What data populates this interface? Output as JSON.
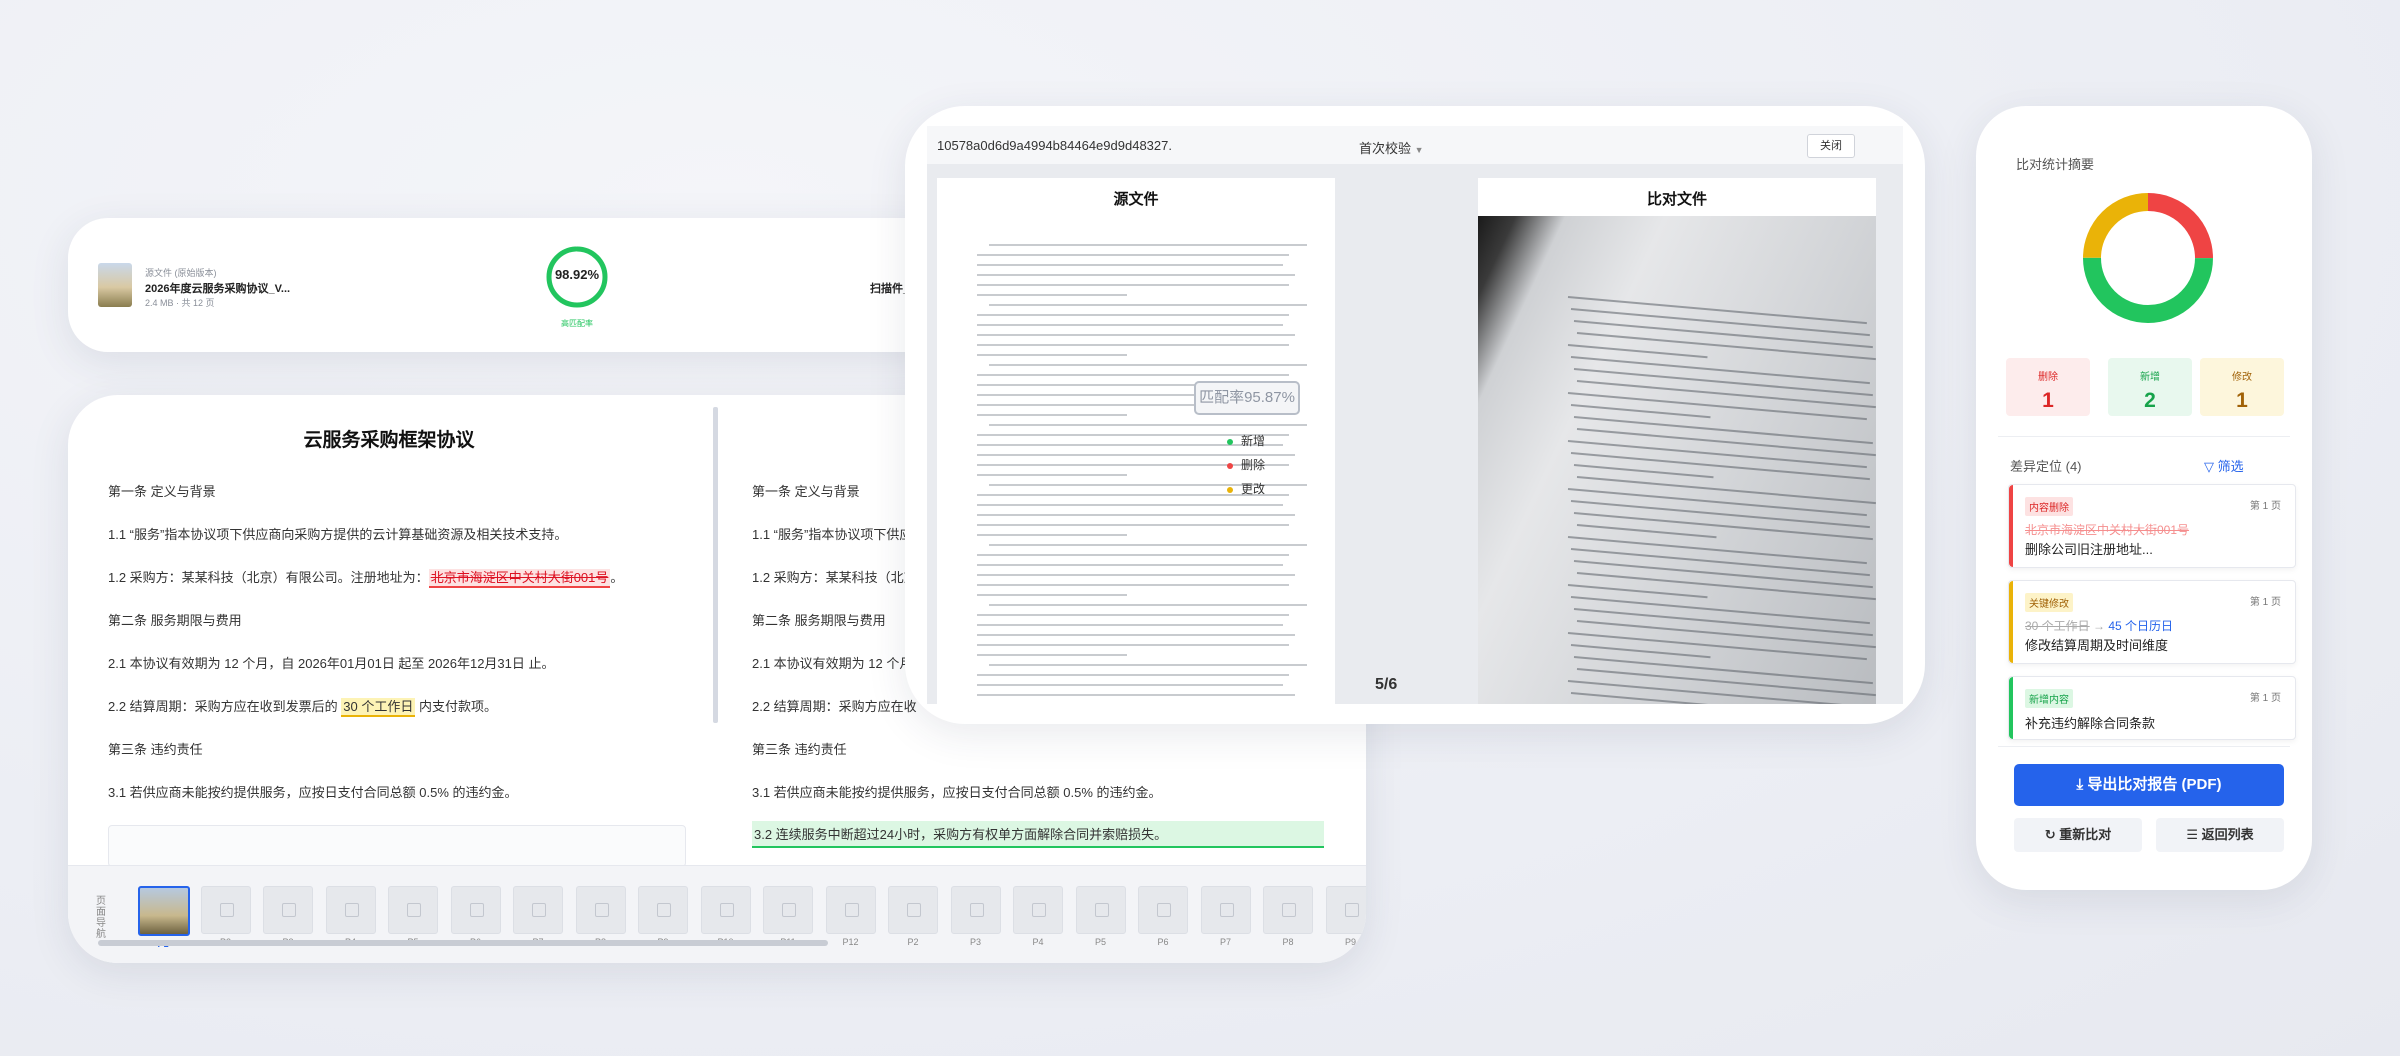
{
  "top_card": {
    "source_tag": "源文件 (原始版本)",
    "source_name": "2026年度云服务采购协议_V...",
    "source_meta": "2.4 MB · 共 12 页",
    "match_rate": "98.92%",
    "match_fraction": 0.9892,
    "match_label": "高匹配率",
    "scan_name": "扫描件_"
  },
  "compare": {
    "title": "云服务采购框架协议",
    "left_lines": [
      "第一条 定义与背景",
      "1.1 “服务”指本协议项下供应商向采购方提供的云计算基础资源及相关技术支持。",
      "1.2 采购方：某某科技（北京）有限公司。注册地址为：",
      "北京市海淀区中关村大街001号",
      "第二条 服务期限与费用",
      "2.1 本协议有效期为 12 个月，自 2026年01月01日 起至 2026年12月31日 止。",
      "2.2 结算周期：采购方应在收到发票后的 ",
      "30 个工作日",
      " 内支付款项。",
      "第三条 违约责任",
      "3.1 若供应商未能按约提供服务，应按日支付合同总额 0.5% 的违约金。"
    ],
    "right_lines": [
      "第一条 定义与背景",
      "1.1 “服务”指本协议项下供应商向采购方提供",
      "1.2 采购方：某某科技（北京",
      "第二条 服务期限与费用",
      "2.1 本协议有效期为 12 个月",
      "2.2 结算周期：采购方应在收",
      "第三条 违约责任",
      "3.1 若供应商未能按约提供服务，应按日支付合同总额 0.5% 的违约金。",
      "3.2 连续服务中断超过24小时，采购方有权单方面解除合同并索赔损失。"
    ],
    "strip_label": "页面导航",
    "pages": [
      "P1",
      "P2",
      "P3",
      "P4",
      "P5",
      "P6",
      "P7",
      "P8",
      "P9",
      "P10",
      "P11",
      "P12",
      "P2",
      "P3",
      "P4",
      "P5",
      "P6",
      "P7",
      "P8",
      "P9"
    ]
  },
  "viewer": {
    "doc_id": "10578a0d6d9a4994b84464e9d9d48327.",
    "mode": "首次校验",
    "close_label": "关闭",
    "source_title": "源文件",
    "compare_title": "比对文件",
    "match_badge": "匹配率95.87%",
    "legend": [
      {
        "label": "新增",
        "color": "#22c55e"
      },
      {
        "label": "删除",
        "color": "#ef4444"
      },
      {
        "label": "更改",
        "color": "#eab308"
      }
    ],
    "page_indicator": "5/6"
  },
  "panel": {
    "summary_title": "比对统计摘要",
    "donut": [
      {
        "name": "删除",
        "value": 1,
        "color": "#ef4444"
      },
      {
        "name": "新增",
        "value": 2,
        "color": "#22c55e"
      },
      {
        "name": "修改",
        "value": 1,
        "color": "#eab308"
      }
    ],
    "stats": [
      {
        "label": "删除",
        "value": "1",
        "color": "#dc2626",
        "bg": "#fdecec"
      },
      {
        "label": "新增",
        "value": "2",
        "color": "#16a34a",
        "bg": "#e8f8ee"
      },
      {
        "label": "修改",
        "value": "1",
        "color": "#a16207",
        "bg": "#fdf6dc"
      }
    ],
    "diff_title": "差异定位 (4)",
    "filter_label": "筛选",
    "diffs": [
      {
        "tag": "内容删除",
        "page": "第 1 页",
        "old": "北京市海淀区中关村大街001号",
        "desc": "删除公司旧注册地址...",
        "color": "#ef4444",
        "tag_bg": "#fde2e2",
        "tag_color": "#dc2626"
      },
      {
        "tag": "关键修改",
        "page": "第 1 页",
        "old": "30 个工作日",
        "new": "45 个日历日",
        "desc": "修改结算周期及时间维度",
        "color": "#eab308",
        "tag_bg": "#fdf3c8",
        "tag_color": "#a16207"
      },
      {
        "tag": "新增内容",
        "page": "第 1 页",
        "old": "",
        "desc": "补充违约解除合同条款",
        "color": "#22c55e",
        "tag_bg": "#dcf7e3",
        "tag_color": "#16a34a"
      }
    ],
    "export_label": "导出比对报告 (PDF)",
    "recompare_label": "重新比对",
    "back_label": "返回列表"
  }
}
